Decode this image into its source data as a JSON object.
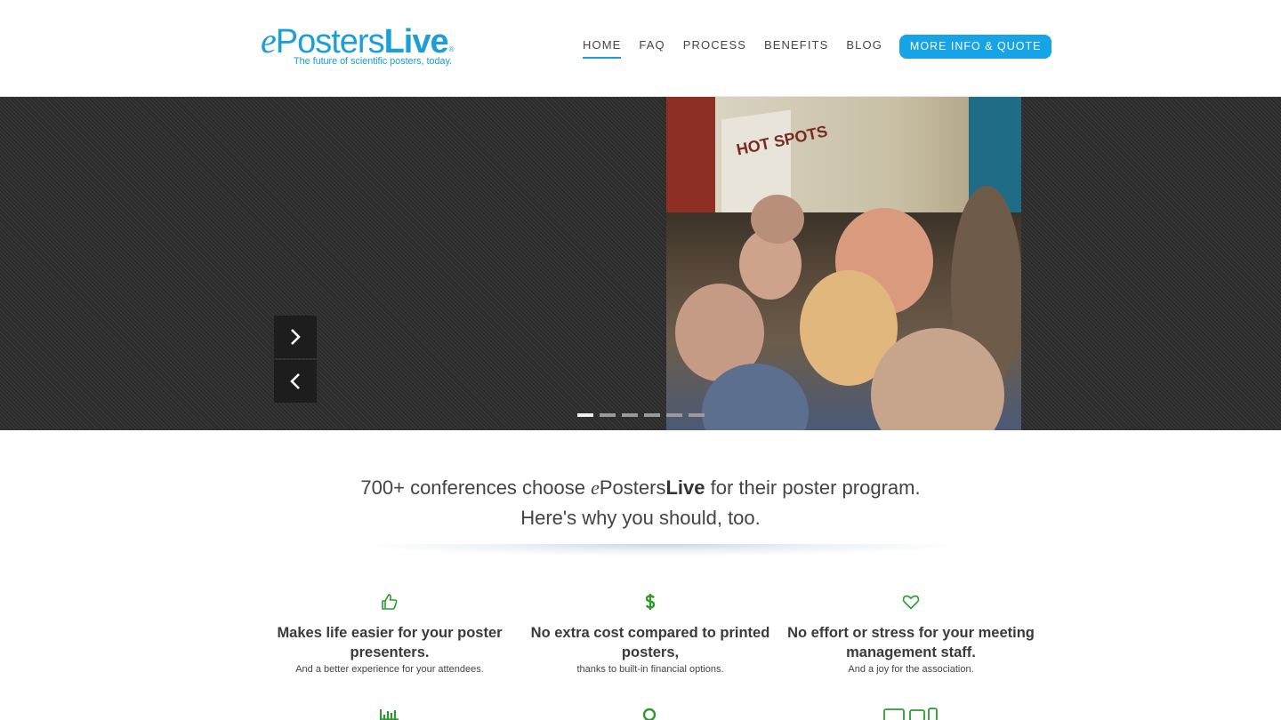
{
  "header": {
    "logo": {
      "e": "e",
      "posters": "Posters",
      "live": "Live",
      "registered": "®",
      "tagline": "The future of scientific posters, today."
    },
    "nav": [
      {
        "label": "HOME",
        "active": true
      },
      {
        "label": "FAQ",
        "active": false
      },
      {
        "label": "PROCESS",
        "active": false
      },
      {
        "label": "BENEFITS",
        "active": false
      },
      {
        "label": "BLOG",
        "active": false
      }
    ],
    "cta_label": "MORE INFO & QUOTE",
    "accent_color": "#16a4e6"
  },
  "hero": {
    "next_icon": "chevron-right-icon",
    "prev_icon": "chevron-left-icon",
    "slide_count": 6,
    "active_slide": 1,
    "photo_sign_text": "HOT SPOTS"
  },
  "intro": {
    "line1_pre": "700+ conferences choose ",
    "brand_e": "e",
    "brand_posters": "Posters",
    "brand_live": "Live",
    "line1_post": " for their poster program.",
    "line2": "Here's why you should, too."
  },
  "features": [
    {
      "icon": "thumbs-up-icon",
      "title": "Makes life easier for your poster presenters.",
      "subtitle": "And a better experience for your attendees."
    },
    {
      "icon": "dollar-icon",
      "title": "No extra cost compared to printed posters,",
      "subtitle": "thanks to built-in financial options."
    },
    {
      "icon": "heart-icon",
      "title": "No effort or stress for your meeting management staff.",
      "subtitle": "And a joy for the association."
    }
  ],
  "feature_icon_color": "#2e9a2e",
  "second_row_icons": [
    "bar-chart-icon",
    "search-icon",
    "devices-icon"
  ]
}
